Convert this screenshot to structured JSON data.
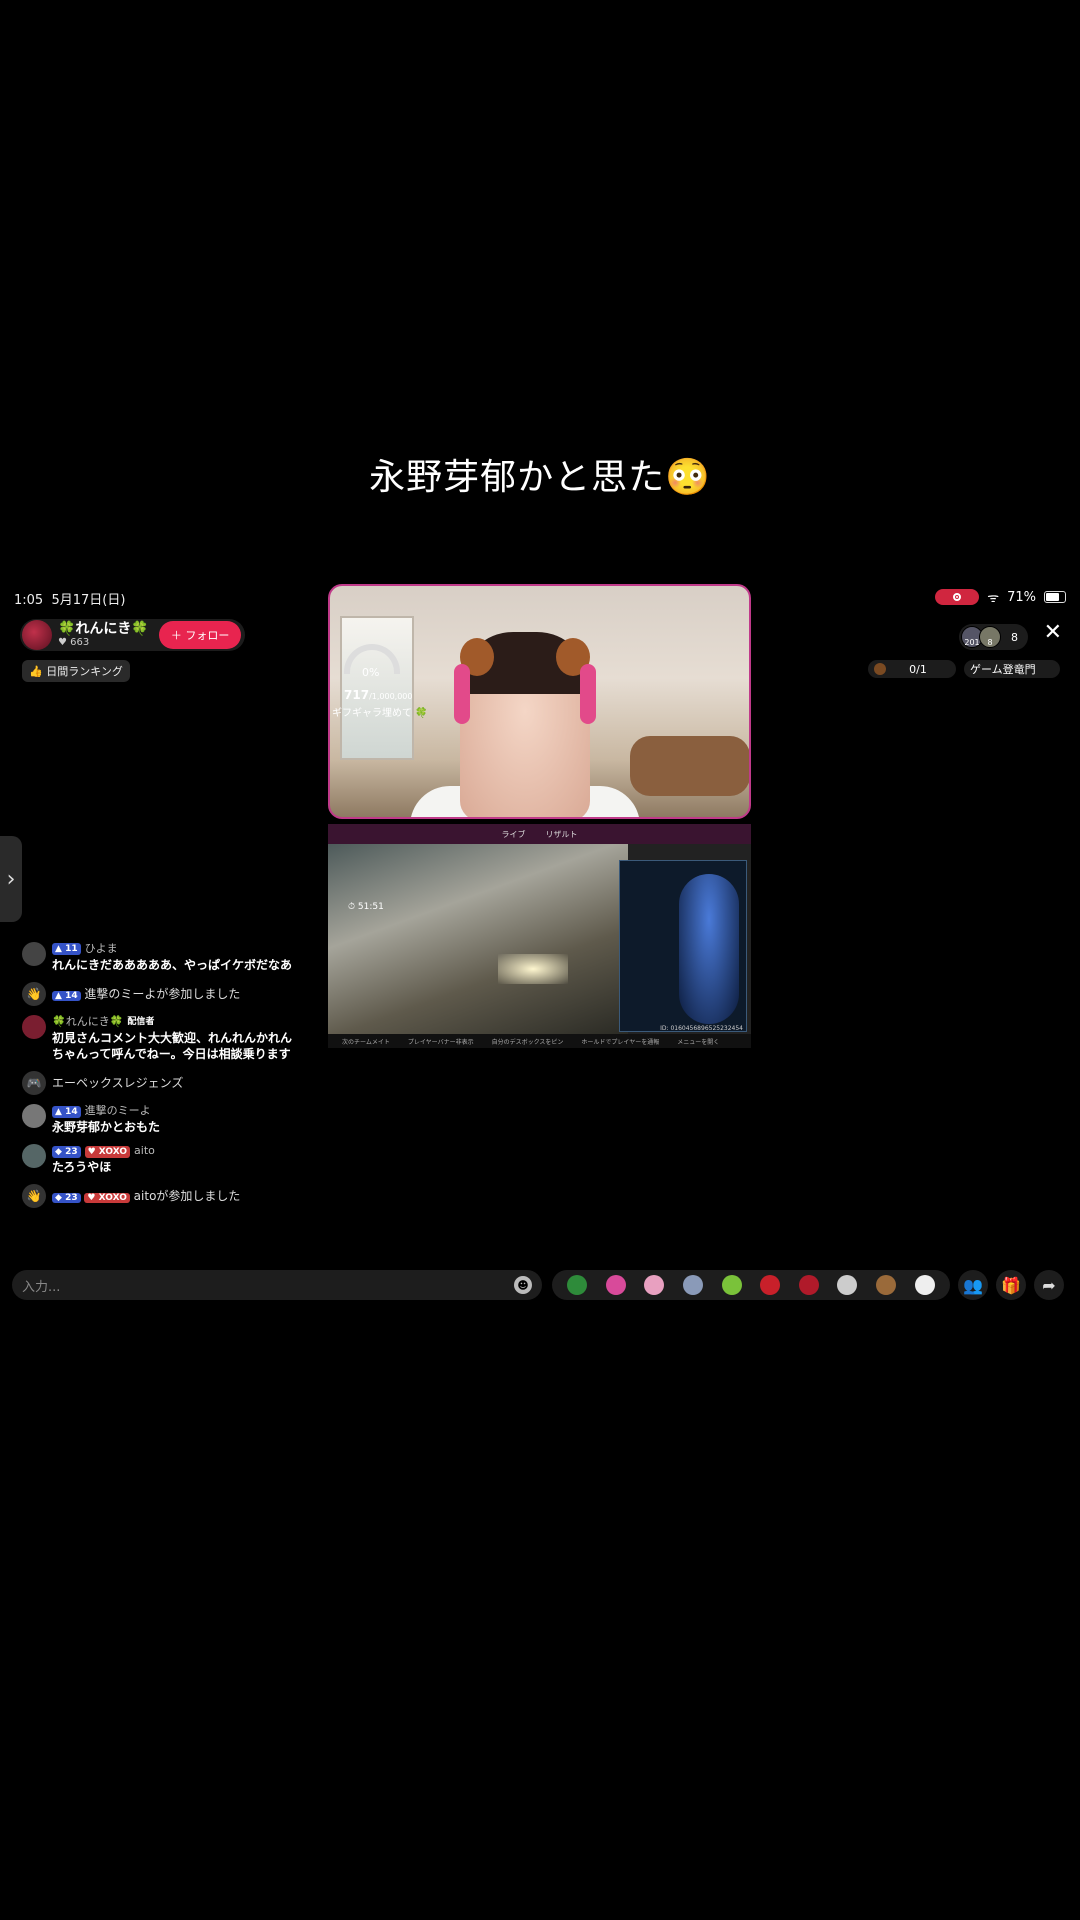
{
  "caption": "永野芽郁かと思た😳",
  "status": {
    "time": "1:05",
    "date": "5月17日(日)",
    "battery": "71%",
    "battery_level": 0.71
  },
  "host": {
    "name": "🍀れんにき🍀",
    "likes": "663",
    "follow_label": "フォロー",
    "ranking": "日間ランキング"
  },
  "viewers": {
    "count": "8",
    "avatars": [
      {
        "badge": "201"
      },
      {
        "badge": "8"
      }
    ]
  },
  "goal": {
    "value": "0/1"
  },
  "game_tag": {
    "label": "ゲーム登竜門"
  },
  "stream": {
    "gauge_pct": "0%",
    "gift_count": "717",
    "gift_total": "/1,000,000",
    "gift_caption": "ギフギャラ埋めて",
    "tab_live": "ライブ",
    "tab_result": "リザルト",
    "timer": "51:51",
    "game_id": "ID: 0160456896525232454",
    "footer": [
      "次のチームメイト",
      "プレイヤーバナー非表示",
      "自分のデスボックスをピン",
      "ホールドでプレイヤーを通報",
      "メニューを開く"
    ]
  },
  "chat": [
    {
      "level": "11",
      "user": "ひよま",
      "text": "れんにきだあああああ、やっぱイケボだなあ",
      "icon": "avatar-icon"
    },
    {
      "level": "14",
      "system": "進撃のミーよが参加しました",
      "icon": "wave-icon"
    },
    {
      "user": "🍀れんにき🍀",
      "tag": "配信者",
      "text": "初見さんコメント大大歓迎、れんれんかれんちゃんって呼んでねー。今日は相談乗ります",
      "icon": "avatar-icon"
    },
    {
      "system": "エーペックスレジェンズ",
      "icon": "gamepad-icon"
    },
    {
      "level": "14",
      "user": "進撃のミーよ",
      "text": "永野芽郁かとおもた",
      "icon": "avatar-icon"
    },
    {
      "level": "23",
      "xoxo": "XOXO",
      "user": "aito",
      "text": "たろうやほ",
      "icon": "avatar-icon"
    },
    {
      "level": "23",
      "xoxo": "XOXO",
      "system": "aitoが参加しました",
      "icon": "wave-icon"
    }
  ],
  "input": {
    "placeholder": "入力..."
  },
  "colors": {
    "accent": "#e8244f",
    "level": "#3553c7",
    "xoxo": "#c83a3a"
  }
}
